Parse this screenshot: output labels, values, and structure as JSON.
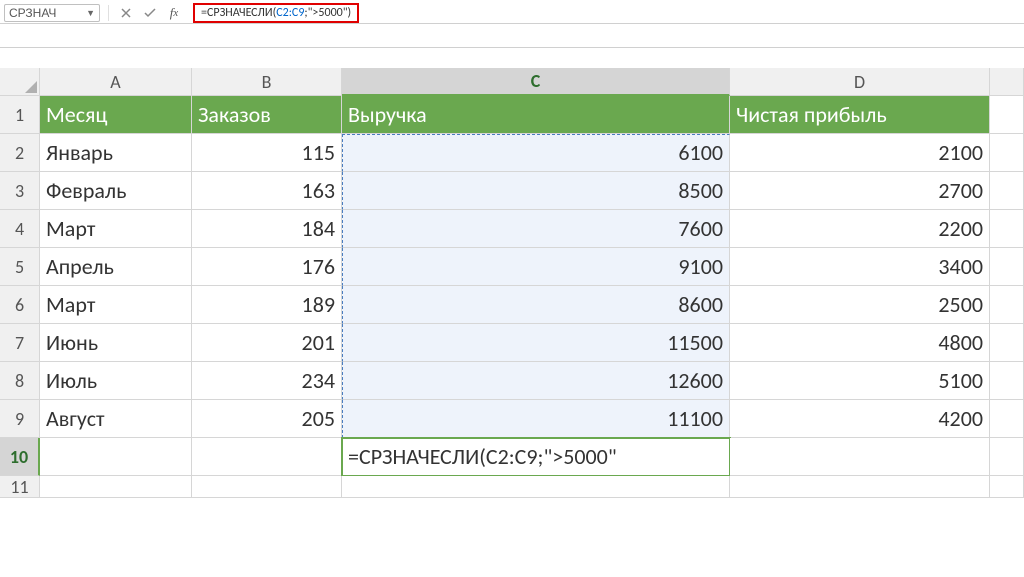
{
  "formula_bar": {
    "name_box": "СРЗНАЧ",
    "formula_prefix": "=СРЗНАЧЕСЛИ(",
    "formula_range": "C2:C9",
    "formula_cond": ";\">5000\")"
  },
  "columns": {
    "A": "A",
    "B": "B",
    "C": "C",
    "D": "D"
  },
  "rownums": [
    "1",
    "2",
    "3",
    "4",
    "5",
    "6",
    "7",
    "8",
    "9",
    "10",
    "11"
  ],
  "headers": {
    "A": "Месяц",
    "B": "Заказов",
    "C": "Выручка",
    "D": "Чистая прибыль"
  },
  "data": [
    {
      "A": "Январь",
      "B": "115",
      "C": "6100",
      "D": "2100"
    },
    {
      "A": "Февраль",
      "B": "163",
      "C": "8500",
      "D": "2700"
    },
    {
      "A": "Март",
      "B": "184",
      "C": "7600",
      "D": "2200"
    },
    {
      "A": "Апрель",
      "B": "176",
      "C": "9100",
      "D": "3400"
    },
    {
      "A": "Март",
      "B": "189",
      "C": "8600",
      "D": "2500"
    },
    {
      "A": "Июнь",
      "B": "201",
      "C": "11500",
      "D": "4800"
    },
    {
      "A": "Июль",
      "B": "234",
      "C": "12600",
      "D": "5100"
    },
    {
      "A": "Август",
      "B": "205",
      "C": "11100",
      "D": "4200"
    }
  ],
  "active_cell_value": "=СРЗНАЧЕСЛИ(C2:C9;\">5000\""
}
